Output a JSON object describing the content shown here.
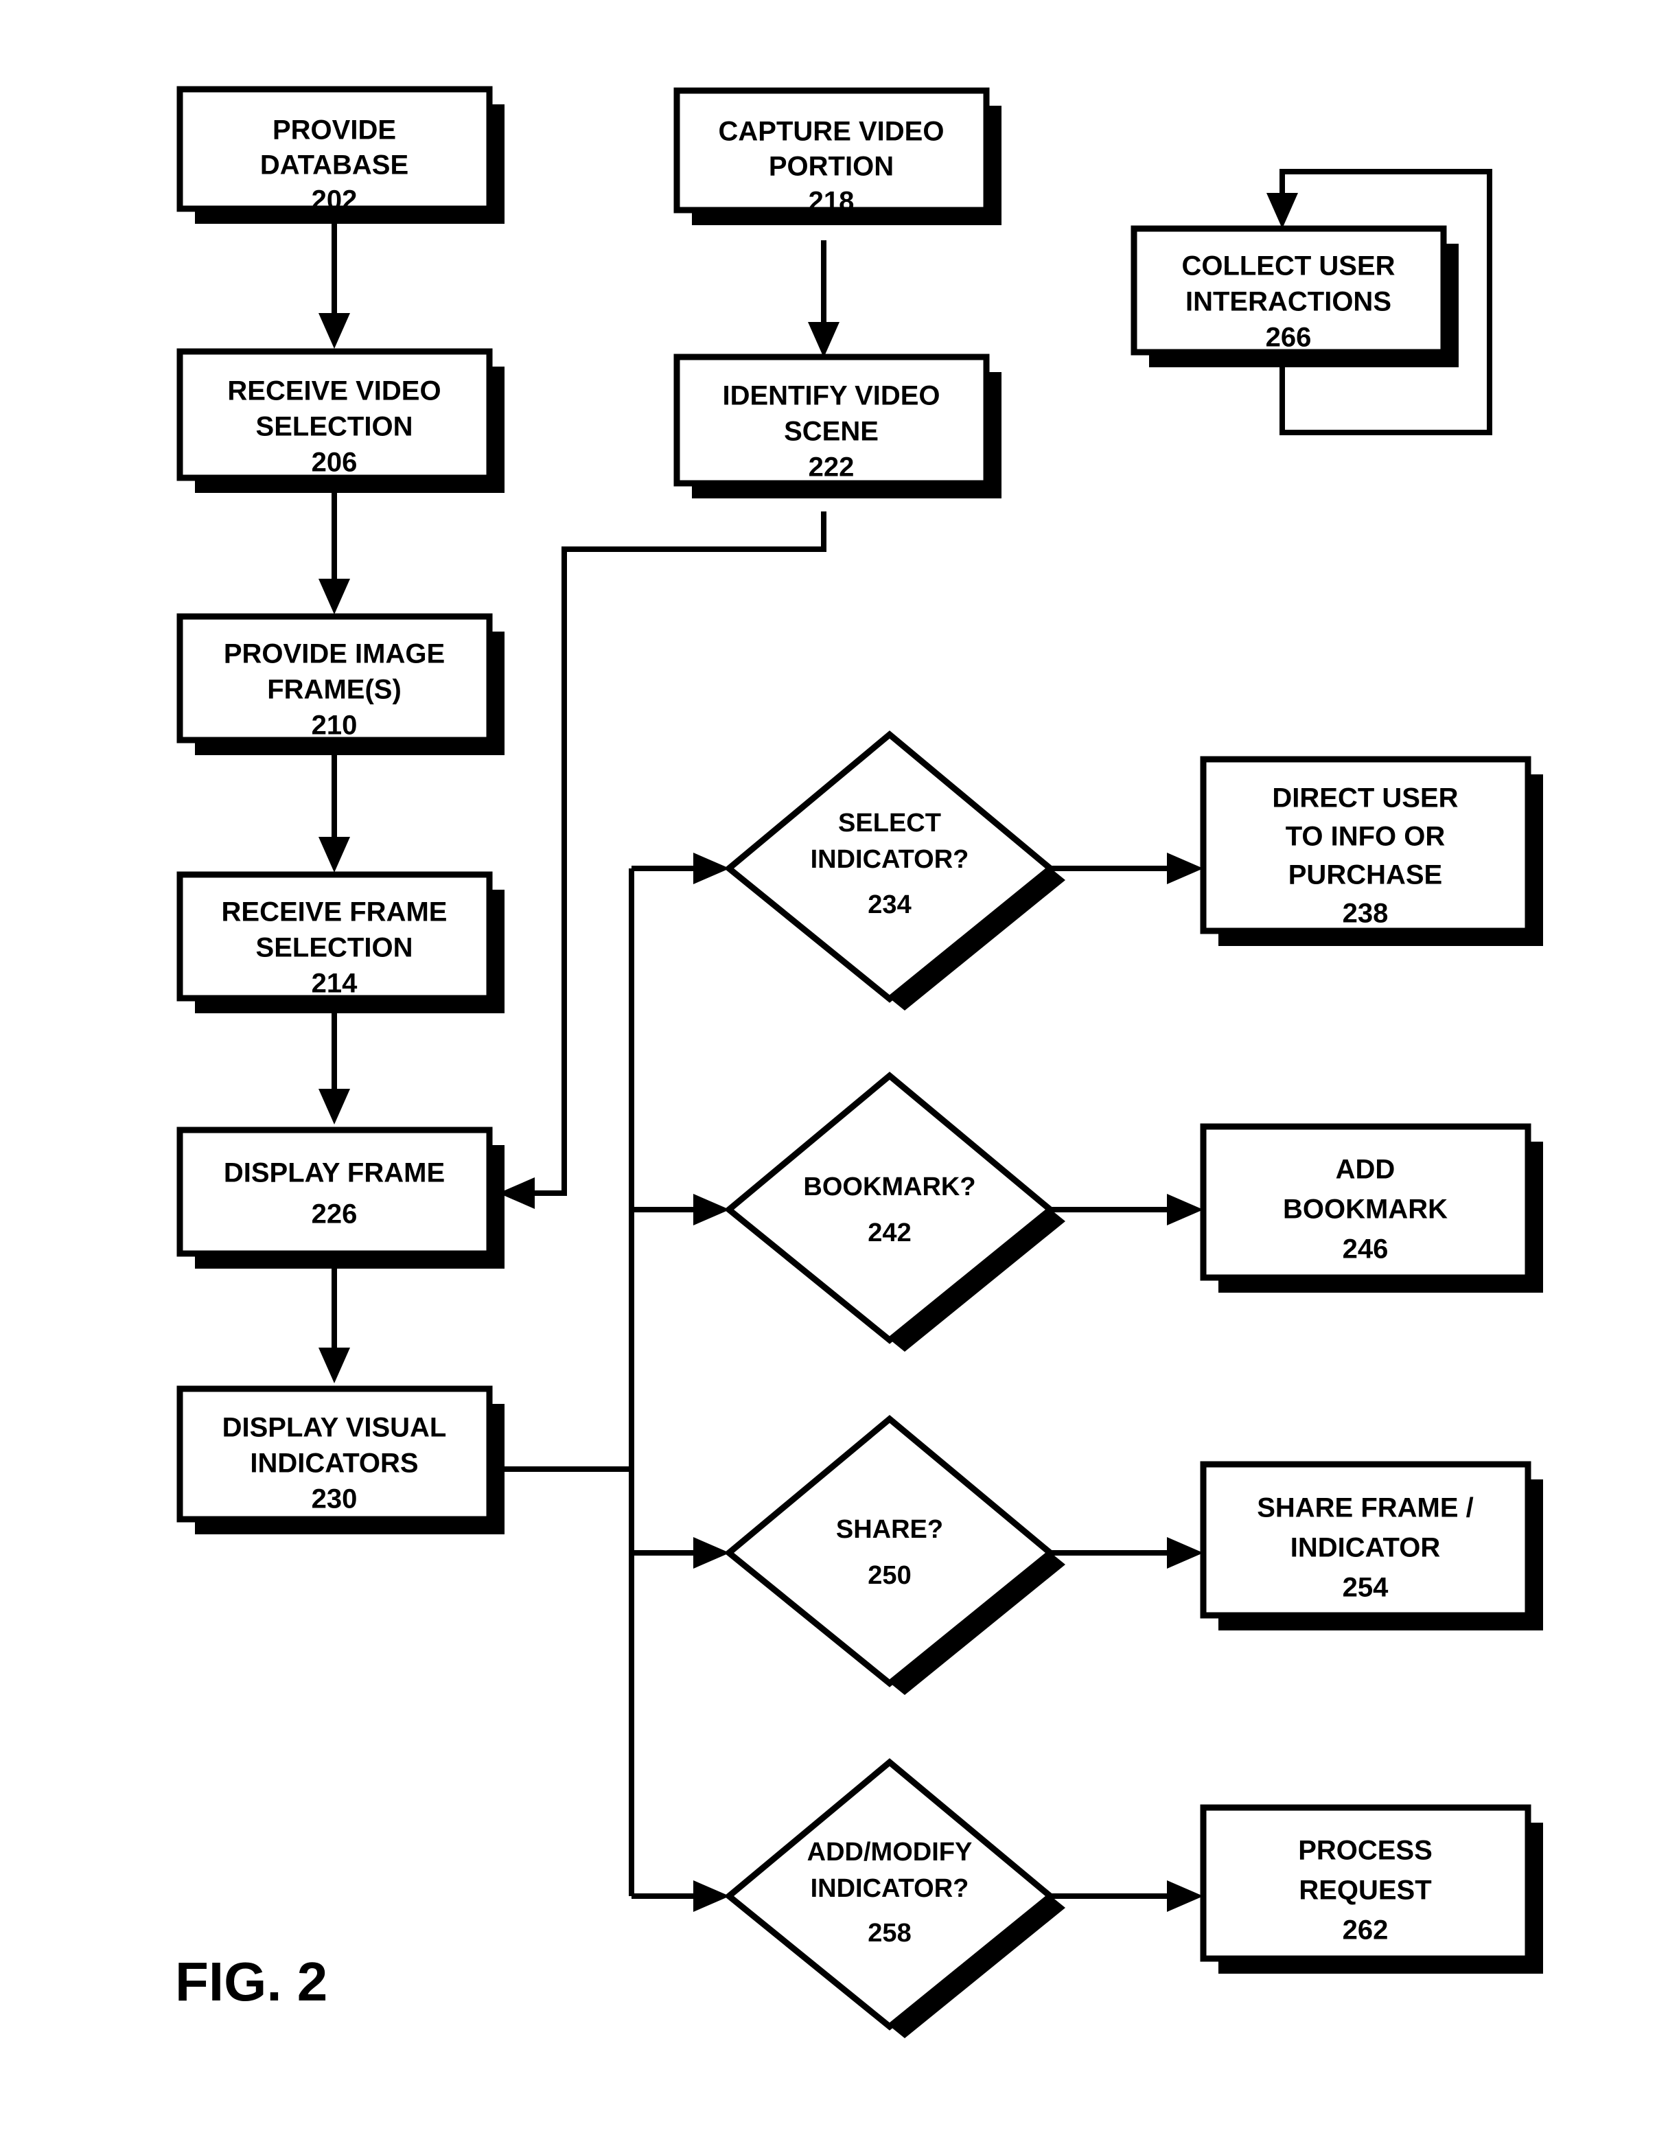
{
  "figure": {
    "label": "FIG. 2",
    "title": "FIG. 2",
    "type": "patent-flowchart",
    "background_color": "#ffffff",
    "line_color": "#000000"
  },
  "nodes": {
    "provide_database": {
      "shape": "process",
      "line1": "PROVIDE",
      "line2": "DATABASE",
      "ref": "202"
    },
    "receive_video_selection": {
      "shape": "process",
      "line1": "RECEIVE VIDEO",
      "line2": "SELECTION",
      "ref": "206"
    },
    "provide_image_frames": {
      "shape": "process",
      "line1": "PROVIDE IMAGE",
      "line2": "FRAME(S)",
      "ref": "210"
    },
    "receive_frame_selection": {
      "shape": "process",
      "line1": "RECEIVE FRAME",
      "line2": "SELECTION",
      "ref": "214"
    },
    "display_frame": {
      "shape": "process",
      "line1": "DISPLAY FRAME",
      "line2": "",
      "ref": "226"
    },
    "display_visual_indicators": {
      "shape": "process",
      "line1": "DISPLAY VISUAL",
      "line2": "INDICATORS",
      "ref": "230"
    },
    "capture_video_portion": {
      "shape": "process",
      "line1": "CAPTURE VIDEO",
      "line2": "PORTION",
      "ref": "218"
    },
    "identify_video_scene": {
      "shape": "process",
      "line1": "IDENTIFY VIDEO",
      "line2": "SCENE",
      "ref": "222"
    },
    "collect_user_interactions": {
      "shape": "process",
      "line1": "COLLECT USER",
      "line2": "INTERACTIONS",
      "ref": "266"
    },
    "select_indicator": {
      "shape": "decision",
      "line1": "SELECT",
      "line2": "INDICATOR?",
      "ref": "234"
    },
    "direct_user": {
      "shape": "process",
      "line1": "DIRECT USER",
      "line2": "TO INFO OR",
      "line3": "PURCHASE",
      "ref": "238"
    },
    "bookmark": {
      "shape": "decision",
      "line1": "BOOKMARK?",
      "line2": "",
      "ref": "242"
    },
    "add_bookmark": {
      "shape": "process",
      "line1": "ADD",
      "line2": "BOOKMARK",
      "ref": "246"
    },
    "share": {
      "shape": "decision",
      "line1": "SHARE?",
      "line2": "",
      "ref": "250"
    },
    "share_frame_indicator": {
      "shape": "process",
      "line1": "SHARE FRAME /",
      "line2": "INDICATOR",
      "ref": "254"
    },
    "add_modify_indicator": {
      "shape": "decision",
      "line1": "ADD/MODIFY",
      "line2": "INDICATOR?",
      "ref": "258"
    },
    "process_request": {
      "shape": "process",
      "line1": "PROCESS",
      "line2": "REQUEST",
      "ref": "262"
    }
  },
  "connections": [
    {
      "from": "provide_database",
      "to": "receive_video_selection",
      "arrow": true
    },
    {
      "from": "receive_video_selection",
      "to": "provide_image_frames",
      "arrow": true
    },
    {
      "from": "provide_image_frames",
      "to": "receive_frame_selection",
      "arrow": true
    },
    {
      "from": "receive_frame_selection",
      "to": "display_frame",
      "arrow": true
    },
    {
      "from": "display_frame",
      "to": "display_visual_indicators",
      "arrow": true
    },
    {
      "from": "capture_video_portion",
      "to": "identify_video_scene",
      "arrow": true
    },
    {
      "from": "identify_video_scene",
      "to": "display_frame",
      "arrow": true
    },
    {
      "from": "display_visual_indicators",
      "to": "select_indicator",
      "arrow": true
    },
    {
      "from": "display_visual_indicators",
      "to": "bookmark",
      "arrow": true
    },
    {
      "from": "display_visual_indicators",
      "to": "share",
      "arrow": true
    },
    {
      "from": "display_visual_indicators",
      "to": "add_modify_indicator",
      "arrow": true
    },
    {
      "from": "select_indicator",
      "to": "direct_user",
      "arrow": true
    },
    {
      "from": "bookmark",
      "to": "add_bookmark",
      "arrow": true
    },
    {
      "from": "share",
      "to": "share_frame_indicator",
      "arrow": true
    },
    {
      "from": "add_modify_indicator",
      "to": "process_request",
      "arrow": true
    },
    {
      "from": "collect_user_interactions",
      "to": "collect_user_interactions",
      "arrow": true,
      "style": "self-loop"
    }
  ]
}
